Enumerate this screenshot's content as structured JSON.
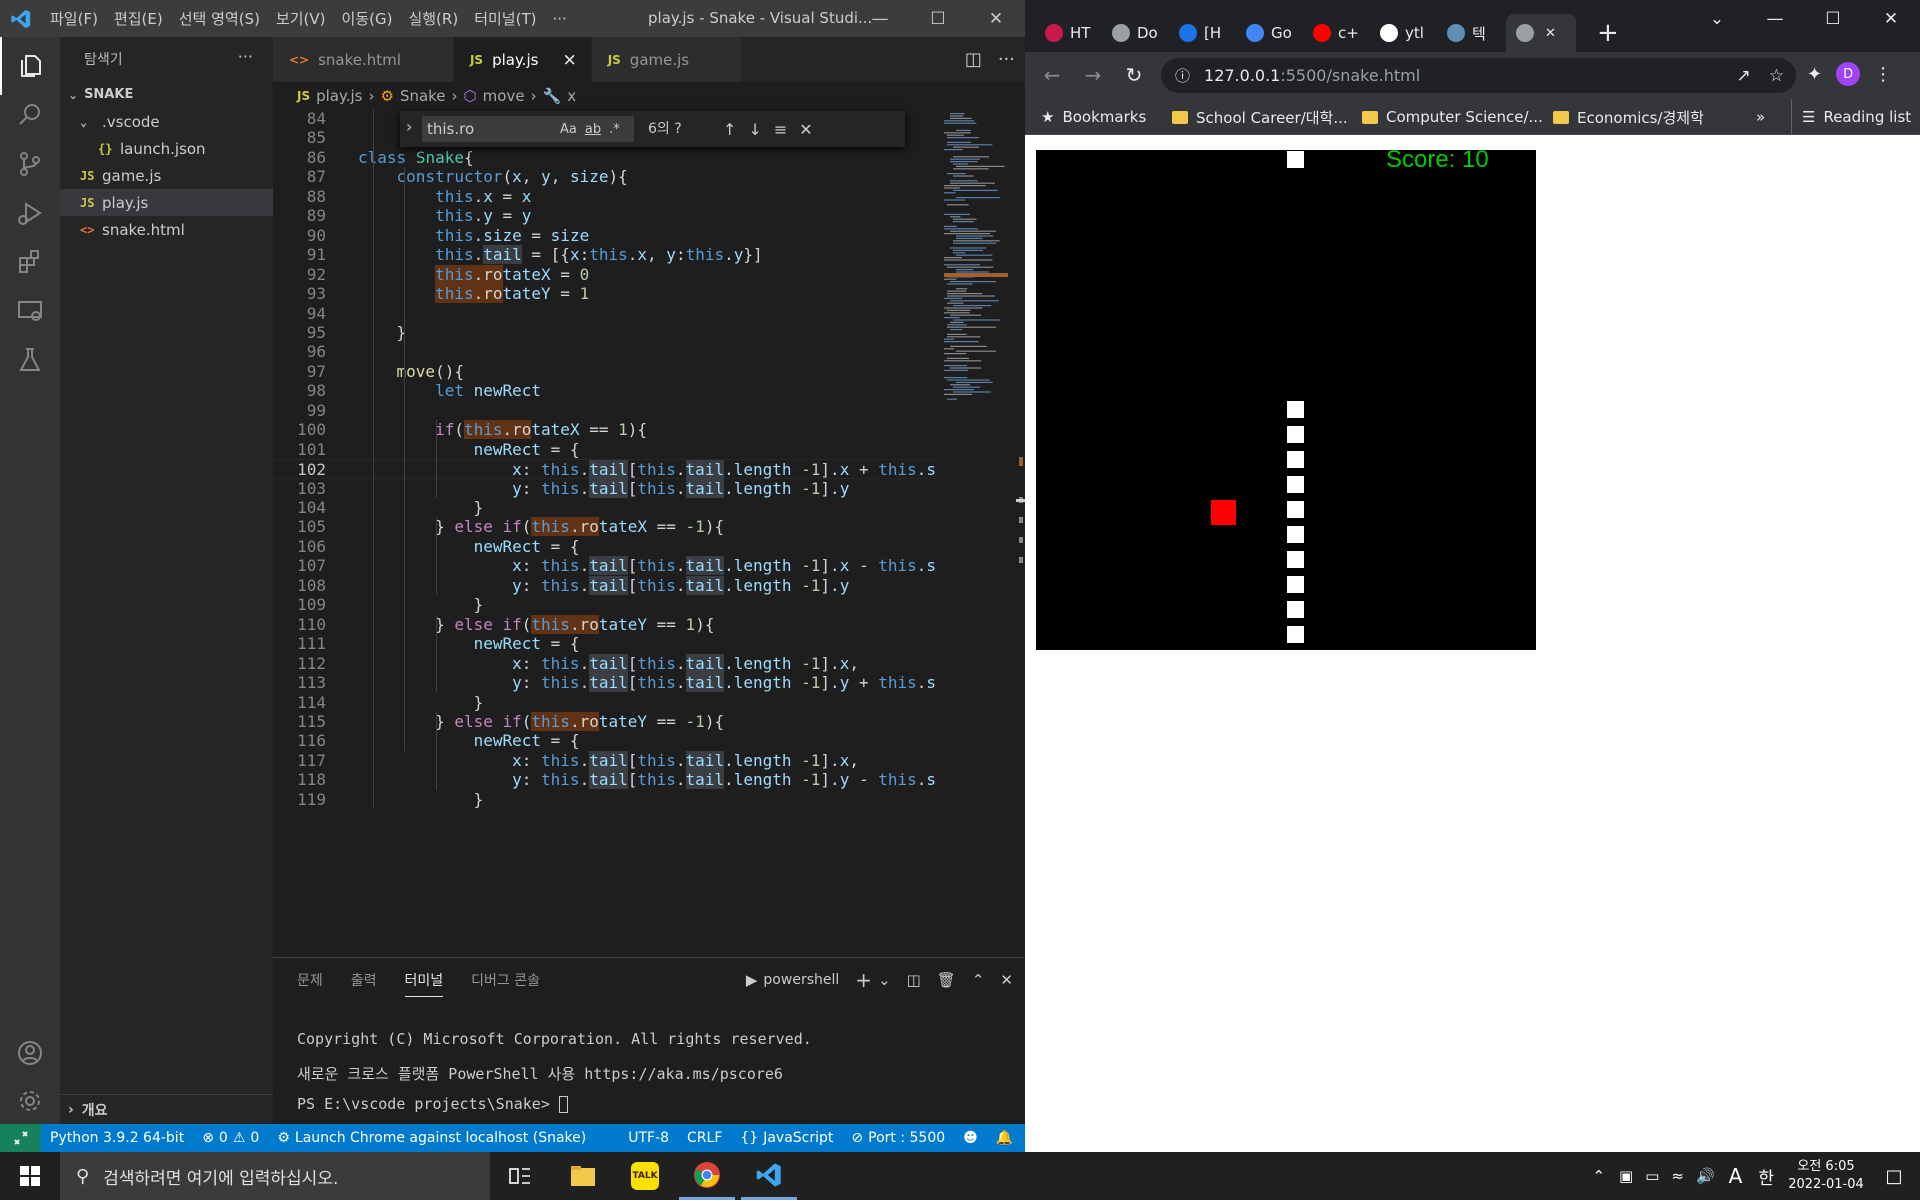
{
  "vscode": {
    "title": "play.js - Snake - Visual Studi...",
    "menu": [
      "파일(F)",
      "편집(E)",
      "선택 영역(S)",
      "보기(V)",
      "이동(G)",
      "실행(R)",
      "터미널(T)",
      "···"
    ],
    "sidebar": {
      "title": "탐색기",
      "root": "SNAKE",
      "items": [
        {
          "label": ".vscode",
          "icon": "chevron-down-icon",
          "indent": 1
        },
        {
          "label": "launch.json",
          "icon": "json-icon",
          "indent": 2
        },
        {
          "label": "game.js",
          "icon": "js-icon",
          "indent": 1
        },
        {
          "label": "play.js",
          "icon": "js-icon",
          "indent": 1,
          "selected": true
        },
        {
          "label": "snake.html",
          "icon": "html-icon",
          "indent": 1
        }
      ],
      "outline_label": "개요"
    },
    "tabs": [
      {
        "label": "snake.html",
        "icon": "html-icon",
        "active": false
      },
      {
        "label": "play.js",
        "icon": "js-icon",
        "active": true
      },
      {
        "label": "game.js",
        "icon": "js-icon",
        "active": false
      }
    ],
    "breadcrumb": [
      "play.js",
      "Snake",
      "move",
      "x"
    ],
    "find": {
      "value": "this.ro",
      "count": "6의 ?",
      "opt_case": "Aa",
      "opt_word": "ab",
      "opt_regex": ".*"
    },
    "code_first_line": 84,
    "current_line": 102,
    "code": [
      "",
      "",
      "class Snake{",
      "    constructor(x, y, size){",
      "        this.x = x",
      "        this.y = y",
      "        this.size = size",
      "        this.tail = [{x:this.x, y:this.y}]",
      "        this.rotateX = 0",
      "        this.rotateY = 1",
      "",
      "    }",
      "",
      "    move(){",
      "        let newRect",
      "",
      "        if(this.rotateX == 1){",
      "            newRect = {",
      "                x: this.tail[this.tail.length -1].x + this.s",
      "                y: this.tail[this.tail.length -1].y",
      "            }",
      "        } else if(this.rotateX == -1){",
      "            newRect = {",
      "                x: this.tail[this.tail.length -1].x - this.s",
      "                y: this.tail[this.tail.length -1].y",
      "            }",
      "        } else if(this.rotateY == 1){",
      "            newRect = {",
      "                x: this.tail[this.tail.length -1].x,",
      "                y: this.tail[this.tail.length -1].y + this.s",
      "            }",
      "        } else if(this.rotateY == -1){",
      "            newRect = {",
      "                x: this.tail[this.tail.length -1].x,",
      "                y: this.tail[this.tail.length -1].y - this.s",
      "            }"
    ],
    "panel": {
      "tabs": [
        "문제",
        "출력",
        "터미널",
        "디버그 콘솔"
      ],
      "active_tab": "터미널",
      "shell": "powershell",
      "lines": [
        "Copyright (C) Microsoft Corporation. All rights reserved.",
        "새로운 크로스 플랫폼 PowerShell 사용 https://aka.ms/pscore6",
        "PS E:\\vscode projects\\Snake> "
      ]
    },
    "status": {
      "python": "Python 3.9.2 64-bit",
      "errors": "0",
      "warnings": "0",
      "launch": "Launch Chrome against localhost (Snake)",
      "encoding": "UTF-8",
      "eol": "CRLF",
      "language": "JavaScript",
      "port": "Port : 5500"
    }
  },
  "chrome": {
    "tabs": [
      {
        "label": "HT",
        "icon": "raspberry-icon"
      },
      {
        "label": "Do",
        "icon": "globe-icon"
      },
      {
        "label": "[H",
        "icon": "mask-icon"
      },
      {
        "label": "Go",
        "icon": "google-translate-icon"
      },
      {
        "label": "c+",
        "icon": "youtube-icon"
      },
      {
        "label": "ytl",
        "icon": "github-icon"
      },
      {
        "label": "텍",
        "icon": "app-icon"
      },
      {
        "label": "",
        "icon": "globe-icon",
        "active": true
      }
    ],
    "url_host": "127.0.0.1",
    "url_rest": ":5500/snake.html",
    "profile_initial": "D",
    "bookmarks": [
      {
        "label": "Bookmarks",
        "icon": "star-icon"
      },
      {
        "label": "School Career/대학...",
        "icon": "folder-icon"
      },
      {
        "label": "Computer Science/...",
        "icon": "folder-icon"
      },
      {
        "label": "Economics/경제학",
        "icon": "folder-icon"
      }
    ],
    "more_bookmarks": "»",
    "reading_list": "Reading list"
  },
  "game": {
    "score_text": "Score: 10",
    "score_color": "#00cc00",
    "apple_color": "#ff0000",
    "snake_color": "#ffffff",
    "background": "#000000"
  },
  "taskbar": {
    "search_placeholder": "검색하려면 여기에 입력하십시오.",
    "time": "오전 6:05",
    "date": "2022-01-04",
    "ime_a": "A",
    "ime_han": "한"
  }
}
